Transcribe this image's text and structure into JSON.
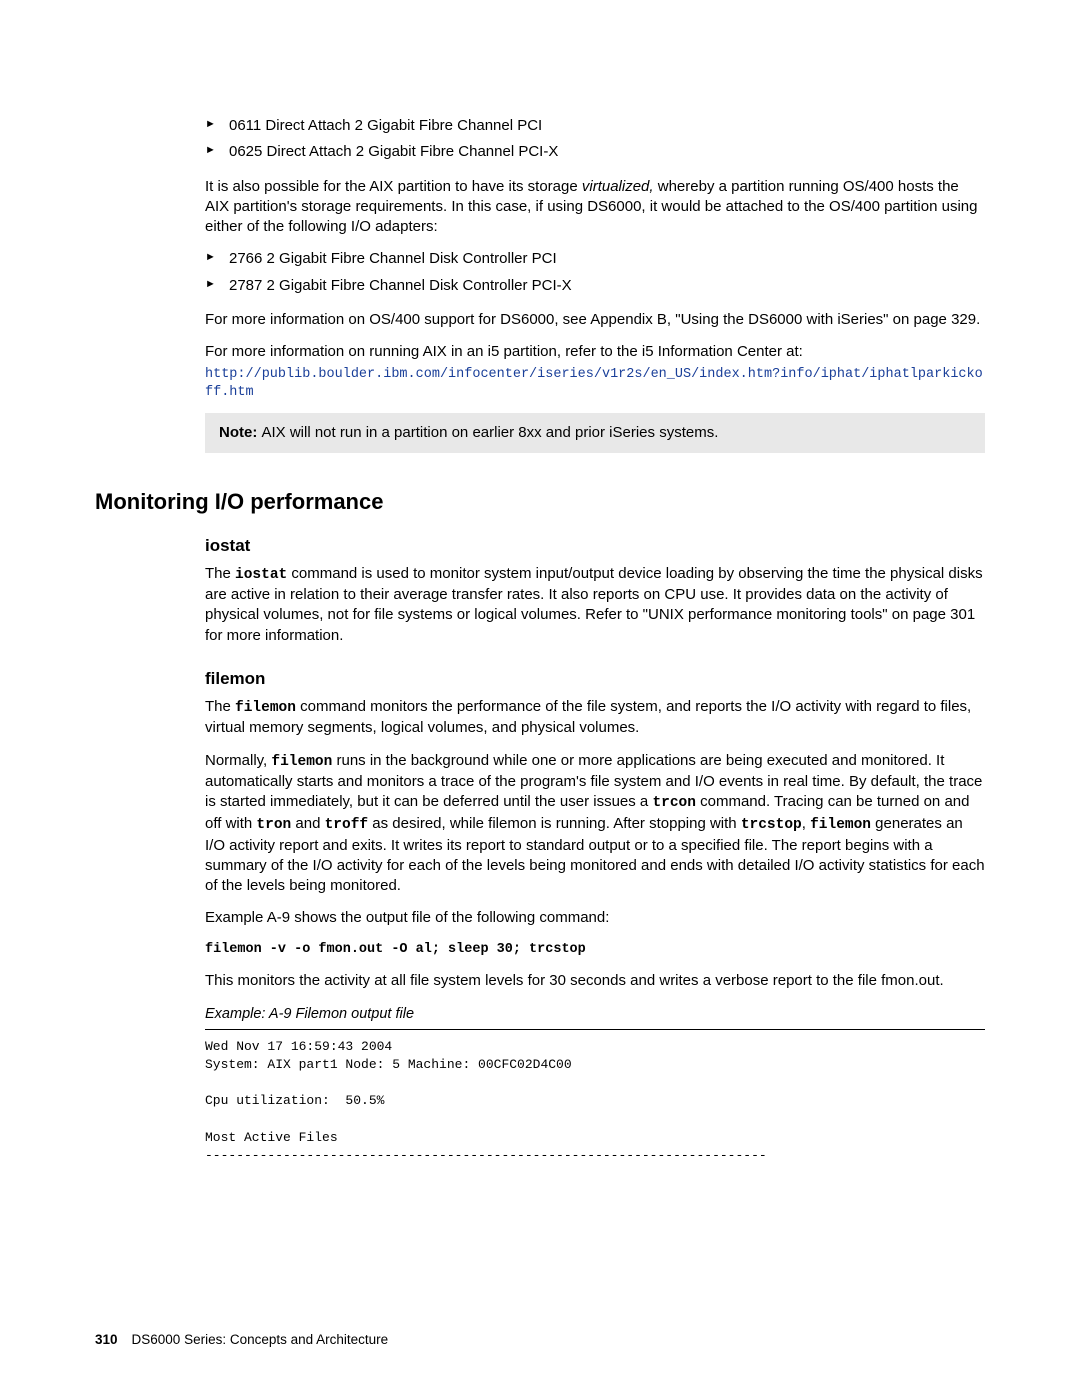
{
  "bullets1": [
    "0611 Direct Attach 2 Gigabit Fibre Channel PCI",
    "0625 Direct Attach 2 Gigabit Fibre Channel PCI-X"
  ],
  "para_virt_a": "It is also possible for the AIX partition to have its storage ",
  "para_virt_ital": "virtualized,",
  "para_virt_b": " whereby a partition running OS/400 hosts the AIX partition's storage requirements. In this case, if using DS6000, it would be attached to the OS/400 partition using either of the following I/O adapters:",
  "bullets2": [
    "2766 2 Gigabit Fibre Channel Disk Controller PCI",
    "2787 2 Gigabit Fibre Channel Disk Controller PCI-X"
  ],
  "para_os400": "For more information on OS/400 support for DS6000, see Appendix B, \"Using the DS6000 with iSeries\" on page 329.",
  "para_aix_i5": "For more information on running AIX in an i5 partition, refer to the i5 Information Center at:",
  "url": "http://publib.boulder.ibm.com/infocenter/iseries/v1r2s/en_US/index.htm?info/iphat/iphatlparkickoff.htm",
  "note_label": "Note: ",
  "note_text": "AIX will not run in a partition on earlier 8xx and prior iSeries systems.",
  "heading_monitor": "Monitoring I/O performance",
  "heading_iostat": "iostat",
  "iostat_p1_a": "The ",
  "iostat_cmd": "iostat",
  "iostat_p1_b": " command is used to monitor system input/output device loading by observing the time the physical disks are active in relation to their average transfer rates. It also reports on CPU use. It provides data on the activity of physical volumes, not for file systems or logical volumes. Refer to \"UNIX performance monitoring tools\" on page 301 for more information.",
  "heading_filemon": "filemon",
  "filemon_p1_a": "The ",
  "filemon_cmd": "filemon",
  "filemon_p1_b": " command monitors the performance of the file system, and reports the I/O activity with regard to files, virtual memory segments, logical volumes, and physical volumes.",
  "filemon_p2_a": "Normally, ",
  "filemon_p2_b": " runs in the background while one or more applications are being executed and monitored. It automatically starts and monitors a trace of the program's file system and I/O events in real time. By default, the trace is started immediately, but it can be deferred until the user issues a ",
  "trcon": "trcon",
  "filemon_p2_c": " command. Tracing can be turned on and off with ",
  "tron": "tron",
  "and_word": " and ",
  "troff": "troff",
  "filemon_p2_d": " as desired, while filemon is running. After stopping with ",
  "trcstop": "trcstop",
  "comma_sp": ", ",
  "filemon_p2_e": " generates an I/O activity report and exits. It writes its report to standard output or to a specified file. The report begins with a summary of the I/O activity for each of the levels being monitored and ends with detailed I/O activity statistics for each of the levels being monitored.",
  "example_intro": "Example A-9 shows the output file of the following command:",
  "cmd_line": "filemon -v -o fmon.out -O al; sleep 30; trcstop",
  "para_monitors": "This monitors the activity at all file system levels for 30 seconds and writes a verbose report to the file fmon.out.",
  "example_caption": "Example: A-9   Filemon output file",
  "code_output": "Wed Nov 17 16:59:43 2004\nSystem: AIX part1 Node: 5 Machine: 00CFC02D4C00\n\nCpu utilization:  50.5%\n\nMost Active Files\n------------------------------------------------------------------------",
  "footer_page": "310",
  "footer_title": "DS6000 Series: Concepts and Architecture"
}
